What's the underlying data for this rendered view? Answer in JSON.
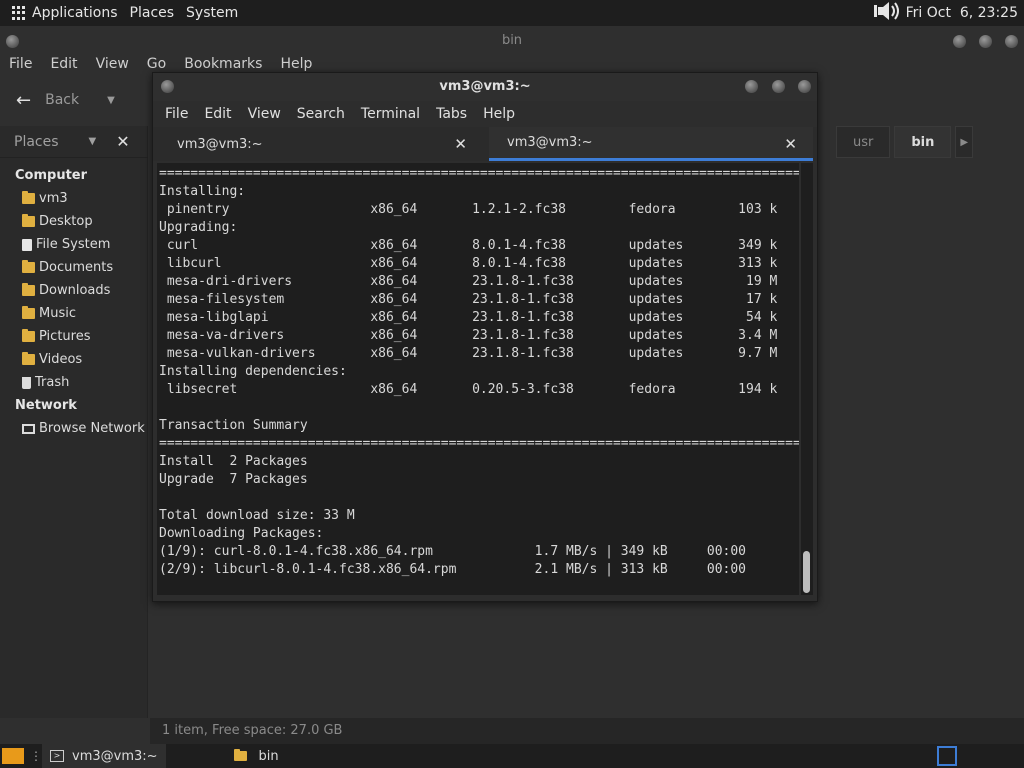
{
  "top_panel": {
    "applications_label": "Applications",
    "places_label": "Places",
    "system_label": "System",
    "clock": "Fri Oct  6, 23:25",
    "volume_icon": "speaker-icon"
  },
  "file_manager": {
    "title": "bin",
    "menu": [
      "File",
      "Edit",
      "View",
      "Go",
      "Bookmarks",
      "Help"
    ],
    "back_label": "Back",
    "places_label": "Places",
    "sidebar": {
      "computer_header": "Computer",
      "computer_items": [
        {
          "label": "vm3",
          "icon": "home-folder-icon"
        },
        {
          "label": "Desktop",
          "icon": "folder-icon"
        },
        {
          "label": "File System",
          "icon": "drive-icon"
        },
        {
          "label": "Documents",
          "icon": "folder-icon"
        },
        {
          "label": "Downloads",
          "icon": "folder-icon"
        },
        {
          "label": "Music",
          "icon": "folder-icon"
        },
        {
          "label": "Pictures",
          "icon": "folder-icon"
        },
        {
          "label": "Videos",
          "icon": "folder-icon"
        },
        {
          "label": "Trash",
          "icon": "trash-icon"
        }
      ],
      "network_header": "Network",
      "network_items": [
        {
          "label": "Browse Network",
          "icon": "monitor-icon"
        }
      ]
    },
    "path_buttons": [
      "usr",
      "bin"
    ],
    "status": "1 item, Free space: 27.0 GB"
  },
  "terminal": {
    "title": "vm3@vm3:~",
    "menu": [
      "File",
      "Edit",
      "View",
      "Search",
      "Terminal",
      "Tabs",
      "Help"
    ],
    "tabs": [
      {
        "label": "vm3@vm3:~",
        "active": false
      },
      {
        "label": "vm3@vm3:~",
        "active": true
      }
    ],
    "lines": [
      "=====================================================================================",
      "Installing:",
      " pinentry                  x86_64       1.2.1-2.fc38        fedora        103 k",
      "Upgrading:",
      " curl                      x86_64       8.0.1-4.fc38        updates       349 k",
      " libcurl                   x86_64       8.0.1-4.fc38        updates       313 k",
      " mesa-dri-drivers          x86_64       23.1.8-1.fc38       updates        19 M",
      " mesa-filesystem           x86_64       23.1.8-1.fc38       updates        17 k",
      " mesa-libglapi             x86_64       23.1.8-1.fc38       updates        54 k",
      " mesa-va-drivers           x86_64       23.1.8-1.fc38       updates       3.4 M",
      " mesa-vulkan-drivers       x86_64       23.1.8-1.fc38       updates       9.7 M",
      "Installing dependencies:",
      " libsecret                 x86_64       0.20.5-3.fc38       fedora        194 k",
      "",
      "Transaction Summary",
      "=====================================================================================",
      "Install  2 Packages",
      "Upgrade  7 Packages",
      "",
      "Total download size: 33 M",
      "Downloading Packages:",
      "(1/9): curl-8.0.1-4.fc38.x86_64.rpm             1.7 MB/s | 349 kB     00:00",
      "(2/9): libcurl-8.0.1-4.fc38.x86_64.rpm          2.1 MB/s | 313 kB     00:00"
    ]
  },
  "taskbar": {
    "items": [
      {
        "label": "vm3@vm3:~",
        "icon": "terminal-icon"
      },
      {
        "label": "bin",
        "icon": "folder-icon"
      }
    ]
  }
}
